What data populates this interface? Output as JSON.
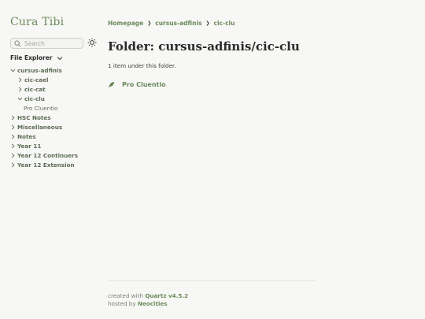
{
  "site": {
    "title": "Cura Tibi"
  },
  "search": {
    "placeholder": "Search"
  },
  "explorer": {
    "heading": "File Explorer",
    "items": [
      {
        "label": "cursus-adfinis"
      },
      {
        "label": "cic-cael"
      },
      {
        "label": "cic-cat"
      },
      {
        "label": "cic-clu"
      },
      {
        "label": "Pro Cluentio"
      },
      {
        "label": "HSC Notes"
      },
      {
        "label": "Miscellaneous"
      },
      {
        "label": "Notes"
      },
      {
        "label": "Year 11"
      },
      {
        "label": "Year 12 Continuers"
      },
      {
        "label": "Year 12 Extension"
      }
    ]
  },
  "breadcrumb": [
    "Homepage",
    "cursus-adfinis",
    "cic-clu"
  ],
  "page": {
    "title": "Folder: cursus-adfinis/cic-clu",
    "count": "1 item under this folder.",
    "items": [
      {
        "label": "Pro Cluentio"
      }
    ]
  },
  "footer": {
    "created_prefix": "created with",
    "created_link": "Quartz v4.5.2",
    "hosted_prefix": "hosted by",
    "hosted_link": "Neocities"
  },
  "colors": {
    "accent": "#6b8a5a",
    "text": "#2b2b2b",
    "background": "#f7f7f5"
  }
}
